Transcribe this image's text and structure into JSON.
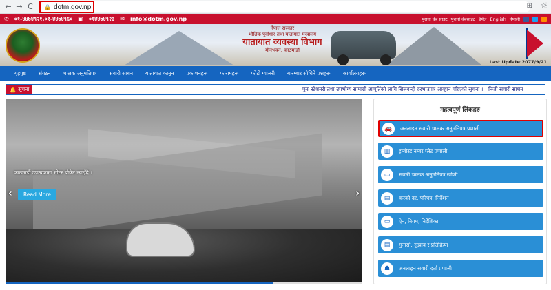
{
  "browser": {
    "url": "dotm.gov.np",
    "nav": {
      "back": "←",
      "forward": "→",
      "reload": "C"
    }
  },
  "topbar": {
    "phone": "०१-४४७४९२१,०१-४४७४९६०",
    "fax": "०१४४७४९२३",
    "email": "info@dotm.gov.np",
    "links": [
      "पुरानो वेब साइट",
      "पुरानो वेबसाइट",
      "ईमेल",
      "English",
      "नेपाली"
    ]
  },
  "header": {
    "gov_line": "नेपाल सरकार",
    "ministry": "भौतिक पूर्वाधार तथा यातायात मन्त्रालय",
    "department": "यातायात व्यवस्था विभाग",
    "location": "मीनभवन, काठमाडौं",
    "last_update": "Last Update:2077/9/21"
  },
  "navbar": {
    "items": [
      "गृहपृष्ठ",
      "संगठन",
      "चालक अनुमतिपत्र",
      "सवारी साधन",
      "यातायात कानून",
      "प्रकाशनहरू",
      "फारामहरू",
      "फोटो ग्यालरी",
      "बारम्बार सोधिने प्रश्नहरू",
      "कार्यालयहरू"
    ]
  },
  "notice": {
    "label": "सूचना",
    "text": "पुनः स्टेशनरी तथा उपभोग्य सामाग्री आपूर्तिको लागि सिलबन्दी दरभाउपत्र आव्हान गरिएको सूचना । ।   निजी सवारी साधन"
  },
  "slider": {
    "caption": "काठमाडौं उपत्यकामा मोटर बोकेर ल्याइँदै ।",
    "read_more": "Read More",
    "progress": 0.75
  },
  "links_panel": {
    "title": "महत्वपूर्ण लिंकहरु",
    "items": [
      {
        "label": "अनलाइन सवारी चालक अनुमतिपत्र प्रणाली",
        "icon": "car-icon"
      },
      {
        "label": "इम्बोस्ड नम्बर प्लेट प्रणाली",
        "icon": "barcode-icon"
      },
      {
        "label": "सवारी चालक अनुमतिपत्र खोजी",
        "icon": "card-icon"
      },
      {
        "label": "करको दर, परिपत्र, निर्देशन",
        "icon": "document-icon"
      },
      {
        "label": "ऐन, नियम, निर्देशिका",
        "icon": "id-card-icon"
      },
      {
        "label": "गुनासो, सुझाव र प्रतिक्रिया",
        "icon": "feedback-icon"
      },
      {
        "label": "अनलाइन सवारी दर्ता प्रणाली",
        "icon": "registration-icon"
      }
    ]
  },
  "colors": {
    "brand_red": "#c8102e",
    "nav_blue": "#1565c0",
    "link_blue": "#2a8fd6"
  }
}
